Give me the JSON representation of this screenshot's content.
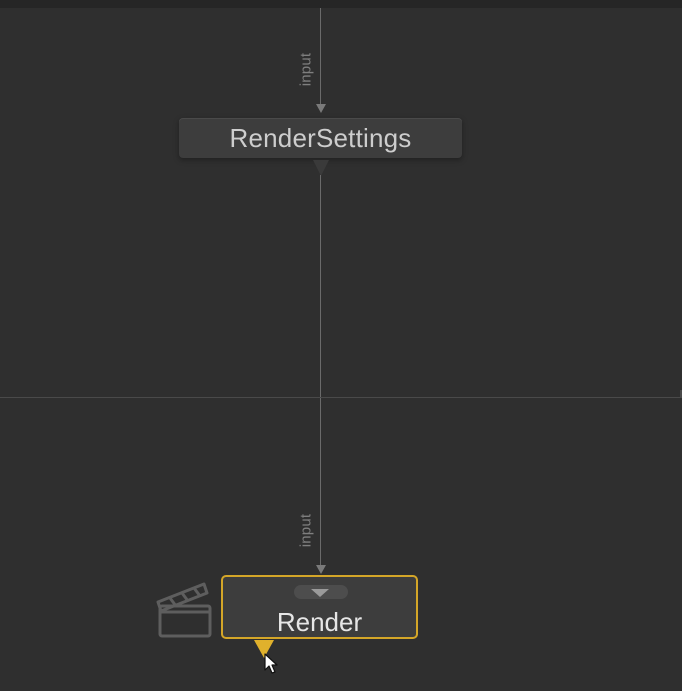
{
  "graph": {
    "nodes": [
      {
        "id": "render-settings",
        "title": "RenderSettings"
      },
      {
        "id": "render",
        "title": "Render",
        "selected": true
      }
    ],
    "port_labels": {
      "render_settings_input": "input",
      "render_input": "input"
    }
  },
  "icons": {
    "render_node_icon": "clapperboard-icon",
    "pointer": "mouse-cursor-icon"
  },
  "colors": {
    "background": "#2f2f2f",
    "node_fill": "#3d3d3d",
    "selection_outline": "#d4a628",
    "wire": "#6a6a6a"
  }
}
